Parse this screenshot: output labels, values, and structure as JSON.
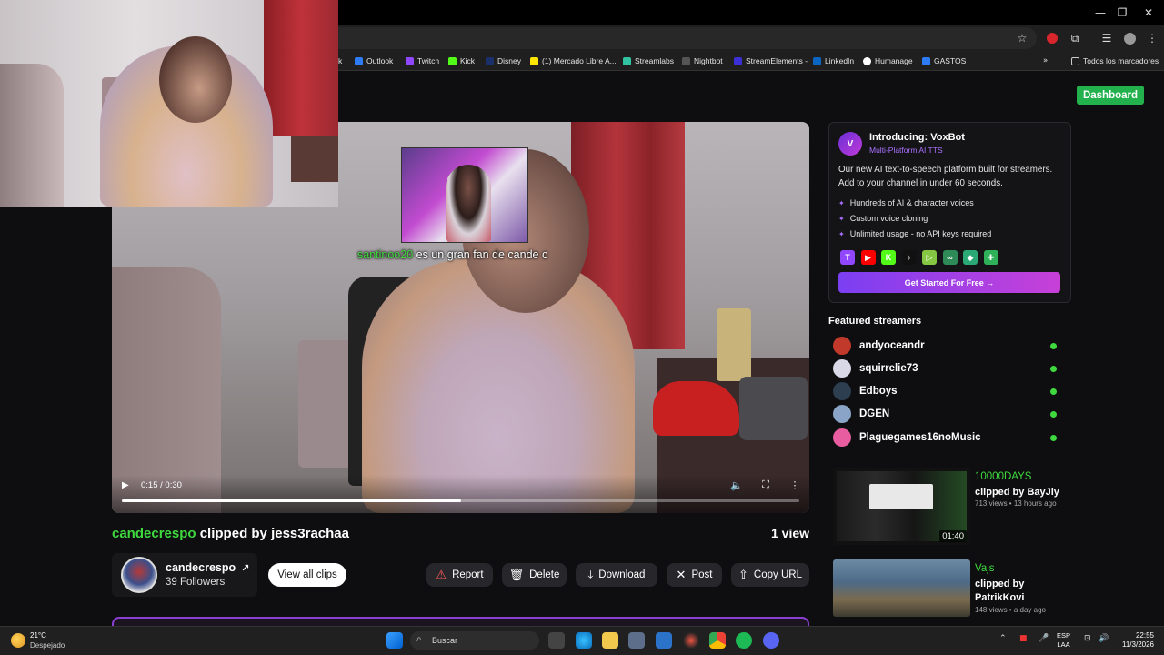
{
  "window": {
    "controls": [
      "—",
      "❐",
      "✕"
    ]
  },
  "bookmarks": [
    {
      "label": "k",
      "color": "#2d7cf6"
    },
    {
      "label": "Outlook",
      "color": "#2d7cf6"
    },
    {
      "label": "Twitch",
      "color": "#9146ff"
    },
    {
      "label": "Kick",
      "color": "#53fc18"
    },
    {
      "label": "Disney",
      "color": "#1b2f6b"
    },
    {
      "label": "(1) Mercado Libre A...",
      "color": "#ffe600"
    },
    {
      "label": "Streamlabs",
      "color": "#31c3a2"
    },
    {
      "label": "Nightbot",
      "color": "#333333"
    },
    {
      "label": "StreamElements -",
      "color": "#3b2fd6"
    },
    {
      "label": "LinkedIn",
      "color": "#0a66c2"
    },
    {
      "label": "Humanage",
      "color": "#ffffff"
    },
    {
      "label": "GASTOS",
      "color": "#2d7cf6"
    }
  ],
  "bookmarks_all": "Todos los marcadores",
  "header": {
    "dashboard_label": "Dashboard"
  },
  "video": {
    "chat_user": "santinoo20",
    "chat_message": "es un gran fan de cande c",
    "time": "0:15 / 0:30",
    "progress_fraction": 0.5
  },
  "clip": {
    "streamer": "candecrespo",
    "clipped_by_text": "clipped by jess3rachaa",
    "views": "1 view"
  },
  "channel": {
    "name": "candecrespo",
    "followers": "39 Followers",
    "view_all_label": "View all clips"
  },
  "actions": {
    "report": "Report",
    "delete": "Delete",
    "download": "Download",
    "post": "Post",
    "copy_url": "Copy URL"
  },
  "promo": {
    "title": "Introducing: VoxBot",
    "subtitle": "Multi-Platform AI TTS",
    "description": "Our new AI text-to-speech platform built for streamers. Add to your channel in under 60 seconds.",
    "features": [
      "Hundreds of AI & character voices",
      "Custom voice cloning",
      "Unlimited usage - no API keys required"
    ],
    "platforms": [
      {
        "name": "twitch-icon",
        "color": "#9146ff",
        "glyph": "T"
      },
      {
        "name": "youtube-icon",
        "color": "#ff0000",
        "glyph": "▶"
      },
      {
        "name": "kick-icon",
        "color": "#53fc18",
        "glyph": "K"
      },
      {
        "name": "tiktok-icon",
        "color": "#111111",
        "glyph": "♪"
      },
      {
        "name": "rumble-icon",
        "color": "#85c742",
        "glyph": "▷"
      },
      {
        "name": "link-icon",
        "color": "#2e8b57",
        "glyph": "∞"
      },
      {
        "name": "kofi-icon",
        "color": "#2aa876",
        "glyph": "◆"
      },
      {
        "name": "puzzle-icon",
        "color": "#2fb15a",
        "glyph": "✚"
      }
    ],
    "cta": "Get Started For Free →"
  },
  "featured": {
    "heading": "Featured streamers",
    "streamers": [
      {
        "name": "andyoceandr",
        "color": "#c0392b"
      },
      {
        "name": "squirrelie73",
        "color": "#d8d8e6"
      },
      {
        "name": "Edboys",
        "color": "#2c3e50"
      },
      {
        "name": "DGEN",
        "color": "#8aa4c8"
      },
      {
        "name": "Plaguegames16noMusic",
        "color": "#e85d9f"
      }
    ]
  },
  "related_clips": [
    {
      "streamer": "10000DAYS",
      "clipper": "clipped by BayJiy",
      "meta": "713 views • 13 hours ago",
      "duration": "01:40"
    },
    {
      "streamer": "Vajs",
      "clipper": "clipped by PatrikKovi",
      "meta": "148 views • a day ago"
    }
  ],
  "taskbar": {
    "temperature": "21°C",
    "condition": "Despejado",
    "search_placeholder": "Buscar",
    "lang_line1": "ESP",
    "lang_line2": "LAA",
    "time": "22:55",
    "date": "11/3/2026"
  }
}
